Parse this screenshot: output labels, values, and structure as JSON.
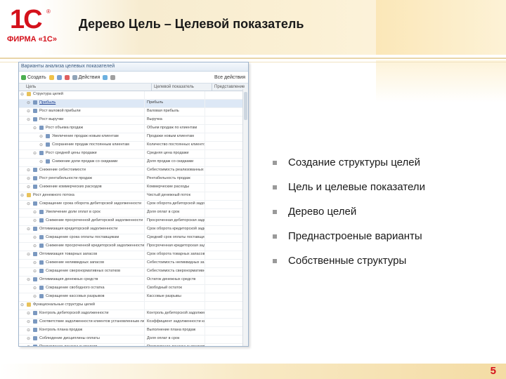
{
  "logo": {
    "mark": "1С",
    "reg": "®",
    "text": "ФИРМА «1С»"
  },
  "header": {
    "title": "Дерево Цель – Целевой показатель"
  },
  "window": {
    "title": "Варианты анализа целевых показателей",
    "toolbar": {
      "create_label": "Создать",
      "actions_label": "Действия",
      "extra_label": "Все действия"
    },
    "columns": [
      "Цель",
      "Целевой показатель",
      "Представление"
    ],
    "rows": [
      {
        "indent": 0,
        "text": "Структура целей",
        "kpi": "",
        "sel": false
      },
      {
        "indent": 1,
        "text": "Прибыль",
        "kpi": "Прибыль",
        "sel": true
      },
      {
        "indent": 1,
        "text": "Рост валовой прибыли",
        "kpi": "Валовая прибыль",
        "sel": false
      },
      {
        "indent": 1,
        "text": "Рост выручки",
        "kpi": "Выручка",
        "sel": false
      },
      {
        "indent": 2,
        "text": "Рост объема продаж",
        "kpi": "Объем продаж по клиентам",
        "sel": false
      },
      {
        "indent": 3,
        "text": "Увеличение продаж новым клиентам",
        "kpi": "Продажи новым клиентам",
        "sel": false
      },
      {
        "indent": 3,
        "text": "Сохранение продаж постоянным клиентам",
        "kpi": "Количество постоянных клиентов",
        "sel": false
      },
      {
        "indent": 2,
        "text": "Рост средней цены продажи",
        "kpi": "Средняя цена продажи",
        "sel": false
      },
      {
        "indent": 3,
        "text": "Снижение доли продаж со скидками",
        "kpi": "Доля продаж со скидками",
        "sel": false
      },
      {
        "indent": 1,
        "text": "Снижение себестоимости",
        "kpi": "Себестоимость реализованных товаров",
        "sel": false
      },
      {
        "indent": 1,
        "text": "Рост рентабельности продаж",
        "kpi": "Рентабельность продаж",
        "sel": false
      },
      {
        "indent": 1,
        "text": "Снижение коммерческих расходов",
        "kpi": "Коммерческие расходы",
        "sel": false
      },
      {
        "indent": 0,
        "text": "Рост денежного потока",
        "kpi": "Чистый денежный поток",
        "sel": false
      },
      {
        "indent": 1,
        "text": "Сокращение срока оборота дебиторской задолженности",
        "kpi": "Срок оборота дебиторской задолженности",
        "sel": false
      },
      {
        "indent": 2,
        "text": "Увеличение доли оплат в срок",
        "kpi": "Доля оплат в срок",
        "sel": false
      },
      {
        "indent": 2,
        "text": "Снижение просроченной дебиторской задолженности",
        "kpi": "Просроченная дебиторская задолженность",
        "sel": false
      },
      {
        "indent": 1,
        "text": "Оптимизация кредиторской задолженности",
        "kpi": "Срок оборота кредиторской задолженности",
        "sel": false
      },
      {
        "indent": 2,
        "text": "Сокращение срока оплаты поставщикам",
        "kpi": "Средний срок оплаты поставщикам",
        "sel": false
      },
      {
        "indent": 2,
        "text": "Снижение просроченной кредиторской задолженности",
        "kpi": "Просроченная кредиторская задолженность",
        "sel": false
      },
      {
        "indent": 1,
        "text": "Оптимизация товарных запасов",
        "kpi": "Срок оборота товарных запасов",
        "sel": false
      },
      {
        "indent": 2,
        "text": "Снижение неликвидных запасов",
        "kpi": "Себестоимость неликвидных запасов",
        "sel": false
      },
      {
        "indent": 2,
        "text": "Сокращение сверхнормативных остатков",
        "kpi": "Себестоимость сверхнормативных остатков",
        "sel": false
      },
      {
        "indent": 1,
        "text": "Оптимизация денежных средств",
        "kpi": "Остаток денежных средств",
        "sel": false
      },
      {
        "indent": 2,
        "text": "Сокращение свободного остатка",
        "kpi": "Свободный остаток",
        "sel": false
      },
      {
        "indent": 2,
        "text": "Сокращение кассовых разрывов",
        "kpi": "Кассовые разрывы",
        "sel": false
      },
      {
        "indent": 0,
        "text": "Функциональные структуры целей",
        "kpi": "",
        "sel": false
      },
      {
        "indent": 1,
        "text": "Контроль дебиторской задолженности",
        "kpi": "Контроль дебиторской задолженности",
        "sel": false
      },
      {
        "indent": 1,
        "text": "Соответствие задолженности клиентов установленным лимитам",
        "kpi": "Коэффициент задолженности клиентов",
        "sel": false
      },
      {
        "indent": 1,
        "text": "Контроль плана продаж",
        "kpi": "Выполнение плана продаж",
        "sel": false
      },
      {
        "indent": 1,
        "text": "Соблюдение дисциплины оплаты",
        "kpi": "Доля оплат в срок",
        "sel": false
      },
      {
        "indent": 1,
        "text": "Поступление денежных средств",
        "kpi": "Поступление денежных средств",
        "sel": false
      }
    ]
  },
  "bullets": [
    "Создание структуры целей",
    "Цель и целевые показатели",
    "Дерево целей",
    "Преднастроеные варианты",
    "Собственные структуры"
  ],
  "page_number": "5",
  "colors": {
    "brand": "#d4111b",
    "bullet": "#9a9a9a"
  }
}
